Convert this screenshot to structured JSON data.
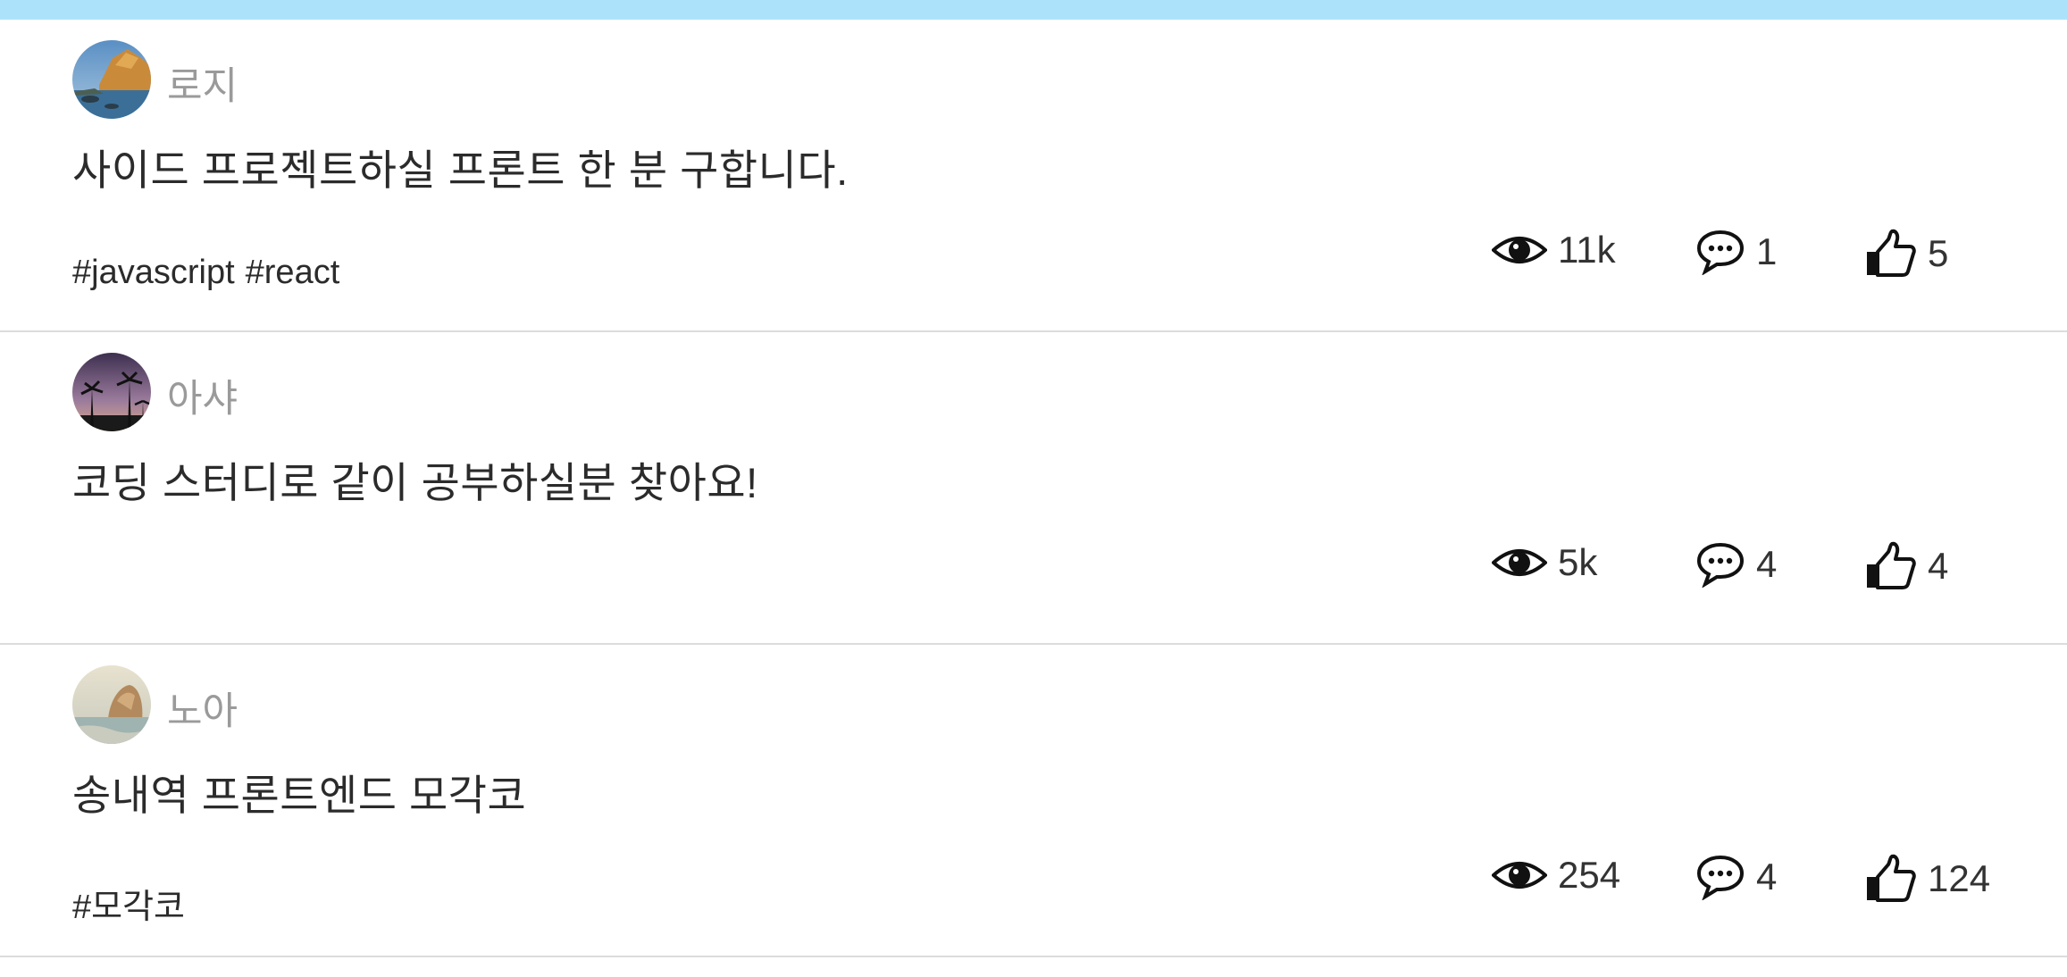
{
  "posts": [
    {
      "author": "로지",
      "title": "사이드 프로젝트하실 프론트 한 분 구합니다.",
      "tags": [
        "#javascript",
        "#react"
      ],
      "views": "11k",
      "comments": "1",
      "likes": "5",
      "avatar": "coastal-cliffs-photo"
    },
    {
      "author": "아샤",
      "title": "코딩 스터디로 같이 공부하실분 찾아요!",
      "tags": [],
      "views": "5k",
      "comments": "4",
      "likes": "4",
      "avatar": "palm-trees-sunset-photo"
    },
    {
      "author": "노아",
      "title": "송내역 프론트엔드 모각코",
      "tags": [
        "#모각코"
      ],
      "views": "254",
      "comments": "4",
      "likes": "124",
      "avatar": "beach-rocks-photo"
    }
  ],
  "icons": {
    "views": "eye-icon",
    "comments": "speech-bubble-icon",
    "likes": "thumbs-up-icon"
  },
  "colors": {
    "topbar": "#ade3fa",
    "divider": "#dcdcdc",
    "author": "#9a9a9a",
    "text": "#2b2b2b"
  }
}
